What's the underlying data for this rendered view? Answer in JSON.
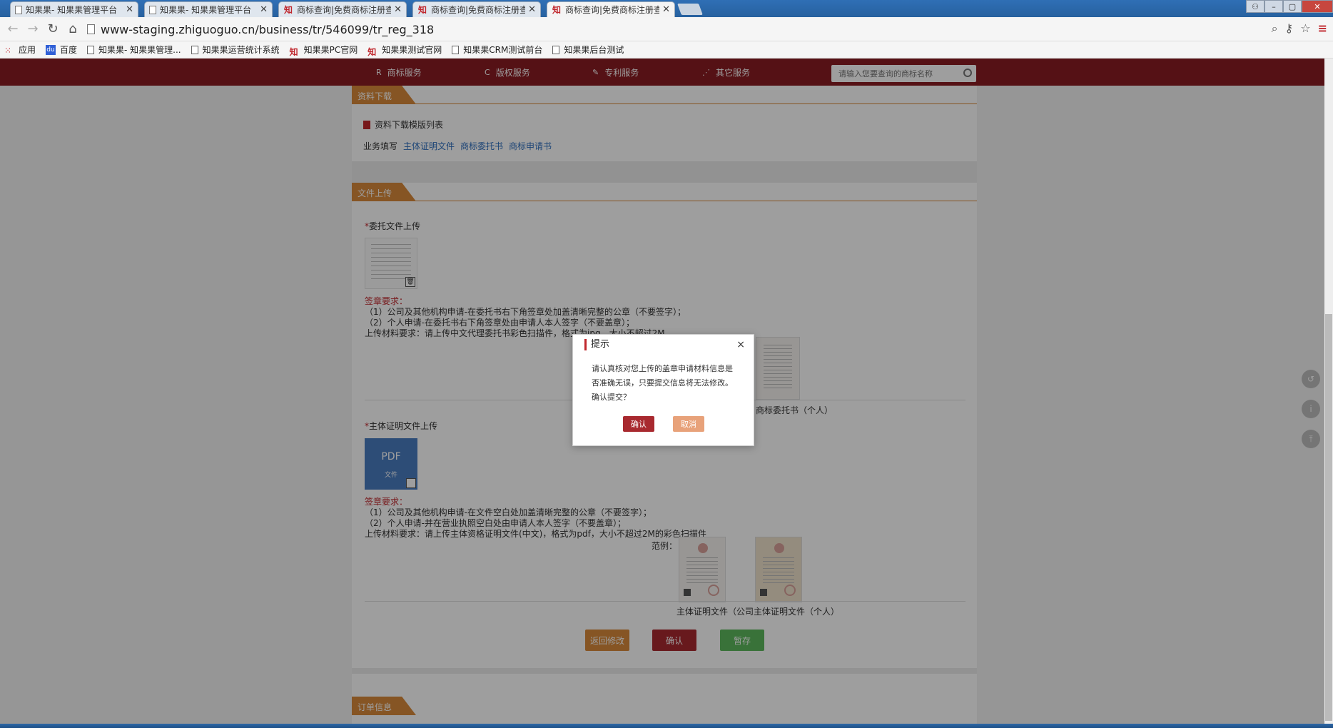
{
  "browser": {
    "tabs": [
      {
        "title": "知果果- 知果果管理平台",
        "icon": "page-icon",
        "active": false
      },
      {
        "title": "知果果- 知果果管理平台",
        "icon": "page-icon",
        "active": false
      },
      {
        "title": "商标查询|免费商标注册查",
        "icon": "zhi-logo-icon",
        "active": false
      },
      {
        "title": "商标查询|免费商标注册查",
        "icon": "zhi-logo-icon",
        "active": false
      },
      {
        "title": "商标查询|免费商标注册查",
        "icon": "zhi-logo-icon",
        "active": true
      }
    ],
    "tab_close": "✕",
    "url": "www-staging.zhiguoguo.cn/business/tr/546099/tr_reg_318",
    "zhi_glyph": "知",
    "bookmarks": [
      {
        "label": "应用",
        "icon": "apps-icon"
      },
      {
        "label": "百度",
        "icon": "baidu-icon"
      },
      {
        "label": "知果果- 知果果管理...",
        "icon": "page-icon"
      },
      {
        "label": "知果果运营统计系统",
        "icon": "page-icon"
      },
      {
        "label": "知果果PC官网",
        "icon": "zhi-logo-icon"
      },
      {
        "label": "知果果测试官网",
        "icon": "zhi-logo-icon"
      },
      {
        "label": "知果果CRM测试前台",
        "icon": "page-icon"
      },
      {
        "label": "知果果后台测试",
        "icon": "page-icon"
      }
    ]
  },
  "site_nav": {
    "items": [
      {
        "glyph": "R",
        "label": "商标服务"
      },
      {
        "glyph": "C",
        "label": "版权服务"
      },
      {
        "glyph": "✎",
        "label": "专利服务"
      },
      {
        "glyph": "⋰",
        "label": "其它服务"
      }
    ],
    "search_placeholder": "请输入您要查询的商标名称"
  },
  "download_section": {
    "tag": "资料下载",
    "template_list": "资料下载模版列表",
    "biz_label": "业务填写",
    "links": [
      "主体证明文件",
      "商标委托书",
      "商标申请书"
    ]
  },
  "upload_section": {
    "tag": "文件上传",
    "star": "*",
    "entrust": {
      "label": "委托文件上传",
      "req_title": "签章要求：",
      "req_1": "（1）公司及其他机构申请-在委托书右下角签章处加盖清晰完整的公章（不要签字）；",
      "req_2": "（2）个人申请-在委托书右下角签章处由申请人本人签字（不要盖章）；",
      "material": "上传材料要求：请上传中文代理委托书彩色扫描件，格式为jpg，大小不超过2M",
      "sample_caption": "商标委托书（个人）"
    },
    "subject": {
      "label": "主体证明文件上传",
      "pdf_label": "PDF",
      "pdf_sub": "文件",
      "req_title": "签章要求：",
      "req_1": "（1）公司及其他机构申请-在文件空白处加盖清晰完整的公章（不要签字）；",
      "req_2": "（2）个人申请-并在营业执照空白处由申请人本人签字（不要盖章）；",
      "material": "上传材料要求：请上传主体资格证明文件(中文)，格式为pdf，大小不超过2M的彩色扫描件",
      "sample_label": "范例：",
      "caption_company": "主体证明文件（公司",
      "caption_person": "主体证明文件（个人）"
    },
    "trash_glyph": "🗑"
  },
  "actions": {
    "back": "返回修改",
    "confirm": "确认",
    "save": "暂存"
  },
  "order_section": {
    "tag": "订单信息"
  },
  "side_icons": [
    "↺",
    "i",
    "⤒"
  ],
  "dialog": {
    "title": "提示",
    "close": "×",
    "message": "请认真核对您上传的盖章申请材料信息是否准确无误，只要提交信息将无法修改。确认提交？",
    "ok": "确认",
    "cancel": "取消"
  },
  "colors": {
    "brand_red": "#8a1c23",
    "accent_orange": "#d88a3a",
    "confirm_red": "#a8292f",
    "save_green": "#5cb85c"
  }
}
